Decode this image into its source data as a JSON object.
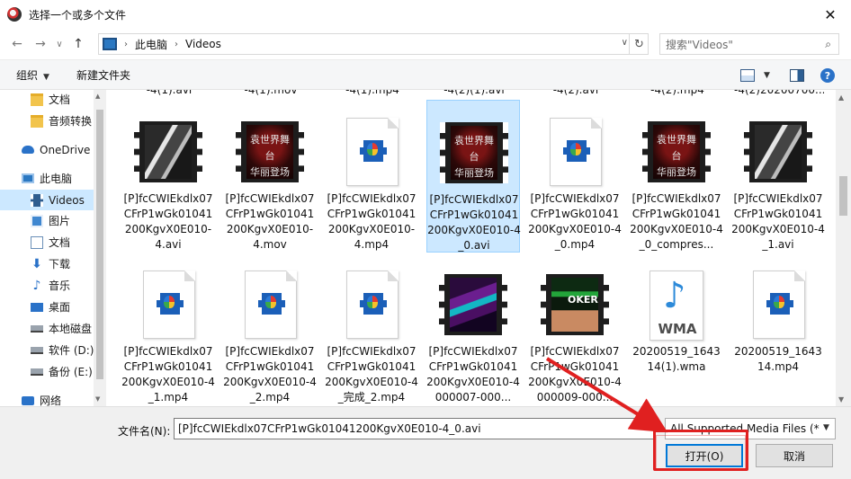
{
  "window": {
    "title": "选择一个或多个文件",
    "close_glyph": "✕"
  },
  "navigation": {
    "back_glyph": "←",
    "forward_glyph": "→",
    "recent_glyph": "∨",
    "up_glyph": "↑",
    "breadcrumb": [
      "此电脑",
      "Videos"
    ],
    "crumb_sep": "›",
    "refresh_glyph": "↻",
    "search_placeholder": "搜索\"Videos\"",
    "search_glyph": "⌕"
  },
  "toolbar": {
    "organize_label": "组织",
    "new_folder_label": "新建文件夹",
    "dropdown_glyph": "▼",
    "help_glyph": "?"
  },
  "sidebar": {
    "items": [
      {
        "label": "文档",
        "icon": "folder-icon",
        "level": 1
      },
      {
        "label": "音频转换",
        "icon": "folder-icon",
        "level": 1
      },
      {
        "label": "OneDrive",
        "icon": "cloud-icon",
        "level": 0
      },
      {
        "label": "此电脑",
        "icon": "computer-icon",
        "level": 0
      },
      {
        "label": "Videos",
        "icon": "video-icon",
        "level": 1,
        "selected": true
      },
      {
        "label": "图片",
        "icon": "pictures-icon",
        "level": 1
      },
      {
        "label": "文档",
        "icon": "documents-icon",
        "level": 1
      },
      {
        "label": "下载",
        "icon": "download-icon",
        "level": 1
      },
      {
        "label": "音乐",
        "icon": "music-icon",
        "level": 1
      },
      {
        "label": "桌面",
        "icon": "desktop-icon",
        "level": 1
      },
      {
        "label": "本地磁盘",
        "icon": "drive-icon",
        "level": 1
      },
      {
        "label": "软件 (D:)",
        "icon": "drive-icon",
        "level": 1
      },
      {
        "label": "备份 (E:)",
        "icon": "drive-icon",
        "level": 1
      },
      {
        "label": "网络",
        "icon": "network-icon",
        "level": 0
      }
    ]
  },
  "files": {
    "partial_row": [
      "-4(1).avi",
      "-4(1).mov",
      "-4(1).mp4",
      "-4(2)(1).avi",
      "-4(2).avi",
      "-4(2).mp4",
      "-4(2)20200700..."
    ],
    "items": [
      {
        "label": "[P]fcCWIEkdlx07CFrP1wGk01041200KgvX0E010-4.avi",
        "thumb": "film-smile"
      },
      {
        "label": "[P]fcCWIEkdlx07CFrP1wGk01041200KgvX0E010-4.mov",
        "thumb": "film-red"
      },
      {
        "label": "[P]fcCWIEkdlx07CFrP1wGk01041200KgvX0E010-4.mp4",
        "thumb": "doc-video"
      },
      {
        "label": "[P]fcCWIEkdlx07CFrP1wGk01041200KgvX0E010-4_0.avi",
        "thumb": "film-red",
        "selected": true
      },
      {
        "label": "[P]fcCWIEkdlx07CFrP1wGk01041200KgvX0E010-4_0.mp4",
        "thumb": "doc-video"
      },
      {
        "label": "[P]fcCWIEkdlx07CFrP1wGk01041200KgvX0E010-4_0_compres...",
        "thumb": "film-red"
      },
      {
        "label": "[P]fcCWIEkdlx07CFrP1wGk01041200KgvX0E010-4_1.avi",
        "thumb": "film-smile"
      },
      {
        "label": "[P]fcCWIEkdlx07CFrP1wGk01041200KgvX0E010-4_1.mp4",
        "thumb": "doc-video"
      },
      {
        "label": "[P]fcCWIEkdlx07CFrP1wGk01041200KgvX0E010-4_2.mp4",
        "thumb": "doc-video"
      },
      {
        "label": "[P]fcCWIEkdlx07CFrP1wGk01041200KgvX0E010-4_完成_2.mp4",
        "thumb": "doc-video"
      },
      {
        "label": "[P]fcCWIEkdlx07CFrP1wGk01041200KgvX0E010-4000007-000...",
        "thumb": "film-dance"
      },
      {
        "label": "[P]fcCWIEkdlx07CFrP1wGk01041200KgvX0E010-4000009-000...",
        "thumb": "film-oker"
      },
      {
        "label": "20200519_164314(1).wma",
        "thumb": "wma"
      },
      {
        "label": "20200519_164314.mp4",
        "thumb": "doc-video"
      }
    ],
    "thumb_text": {
      "red_line1": "袁世界舞台",
      "red_line2": "华丽登场",
      "oker": "OKER",
      "wma": "WMA",
      "note_glyph": "♪"
    }
  },
  "footer": {
    "filename_label": "文件名(N):",
    "filename_value": "[P]fcCWIEkdlx07CFrP1wGk01041200KgvX0E010-4_0.avi",
    "filetype_value": "All Supported Media Files (*",
    "open_label": "打开(O)",
    "cancel_label": "取消"
  },
  "colors": {
    "selection": "#cce8ff",
    "accent": "#0078d7",
    "annotation": "#e02020"
  }
}
